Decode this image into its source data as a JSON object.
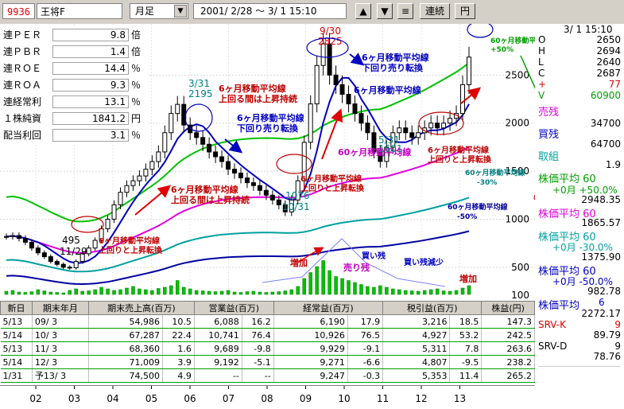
{
  "toolbar": {
    "code": "9936",
    "name": "王将F",
    "period": "月足",
    "daterange": "2001/ 2/28 〜  3/ 1 15:10",
    "btn_up": "▲",
    "btn_down": "▼",
    "btn_menu": "≡",
    "btn_continuous": "連続",
    "btn_yen": "円"
  },
  "fundamentals": [
    {
      "label": "連ＰＥＲ",
      "value": "9.8",
      "unit": "倍"
    },
    {
      "label": "連ＰＢＲ",
      "value": "1.4",
      "unit": "倍"
    },
    {
      "label": "連ＲＯＥ",
      "value": "14.4",
      "unit": "％"
    },
    {
      "label": "連ＲＯＡ",
      "value": "9.3",
      "unit": "％"
    },
    {
      "label": "連経常利",
      "value": "13.1",
      "unit": "％"
    },
    {
      "label": "１株純資",
      "value": "1841.2",
      "unit": "円"
    },
    {
      "label": "配当利回",
      "value": "3.1",
      "unit": "％"
    }
  ],
  "quote": {
    "time": "3/ 1 15:10",
    "rows": [
      {
        "k": "O",
        "v": "2650"
      },
      {
        "k": "H",
        "v": "2694"
      },
      {
        "k": "L",
        "v": "2640"
      },
      {
        "k": "C",
        "v": "2687"
      },
      {
        "k": "+",
        "v": "77"
      },
      {
        "k": "V",
        "v": "60900"
      }
    ],
    "uri_label": "売残",
    "uri_value": "34700",
    "kai_label": "買残",
    "kai_value": "64700",
    "tori_label": "取組",
    "tori_value": "1.9"
  },
  "ma_readouts": [
    {
      "title": "株価平均  60",
      "sub": "+0月 +50.0%",
      "value": "2948.35",
      "color": "#00a000"
    },
    {
      "title": "株価平均  60",
      "sub": "",
      "value": "1865.57",
      "color": "#e000e0"
    },
    {
      "title": "株価平均  60",
      "sub": "+0月 -30.0%",
      "value": "1375.90",
      "color": "#00a0a0"
    },
    {
      "title": "株価平均  60",
      "sub": "+0月 -50.0%",
      "value": "982.78",
      "color": "#0000c0"
    },
    {
      "title": "株価平均",
      "sub": "6",
      "value": "2272.17",
      "color": "#0000c0"
    }
  ],
  "srv": [
    {
      "label": "SRV-K",
      "n": "9",
      "value": "89.79",
      "color": "#e00000"
    },
    {
      "label": "SRV-D",
      "n": "9",
      "value": "78.76",
      "color": "#000000"
    }
  ],
  "annotations": {
    "a1": "6ヶ月移動平均線",
    "a1b": "上回る間は上昇持続",
    "a2": "6ヶ月移動平均線",
    "a2b": "下回り売り転換",
    "a3": "6ヶ月移動平均線",
    "a3b": "上回る間は上昇持続",
    "a4": "6ヶ月移動平均線",
    "a4b": "上回りと上昇転換",
    "a5": "6ヶ月移動平均線",
    "a5b": "上回りと上昇転換",
    "a6": "6ヶ月移動平均線",
    "a6b": "下回り売り転換",
    "a7": "6ヶ月移動平均線",
    "a8": "60ヶ月移動平均線",
    "a9": "6ヶ月移動平均線",
    "a9b": "上回りと上昇転換",
    "a10": "60ヶ月移動平均線",
    "a10b": "+50%",
    "a11": "60ヶ月移動平均線",
    "a11b": "-30%",
    "a12": "60ヶ月移動平均線",
    "a12b": "-50%",
    "v1": "増加",
    "v2": "売り残",
    "v3": "買い残",
    "v4": "買い残減少",
    "v5": "増加"
  },
  "price_labels": [
    {
      "t": "495",
      "c": "#000000"
    },
    {
      "t": "11/29",
      "c": "#000000"
    },
    {
      "t": "3/31",
      "c": "#008080"
    },
    {
      "t": "2195",
      "c": "#008080"
    },
    {
      "t": "9/30",
      "c": "#e00000"
    },
    {
      "t": "2825",
      "c": "#e00000"
    },
    {
      "t": "1076",
      "c": "#008080"
    },
    {
      "t": "10/31",
      "c": "#008080"
    },
    {
      "t": "1601",
      "c": "#008080"
    },
    {
      "t": "5/31",
      "c": "#008080"
    }
  ],
  "table": {
    "headers": [
      "新日",
      "期末年月",
      "期末売上高(百万)",
      "営業益(百万)",
      "経常益(百万)",
      "税引益(百万)",
      "株益(円)"
    ],
    "rows": [
      [
        "5/13",
        "09/ 3",
        "54,986",
        "10.5",
        "6,088",
        "16.2",
        "6,190",
        "17.9",
        "3,216",
        "18.5",
        "147.3"
      ],
      [
        "5/14",
        "10/ 3",
        "67,287",
        "22.4",
        "10,741",
        "76.4",
        "10,926",
        "76.5",
        "4,927",
        "53.2",
        "242.5"
      ],
      [
        "5/13",
        "11/ 3",
        "68,360",
        "1.6",
        "9,689",
        "-9.8",
        "9,929",
        "-9.1",
        "5,311",
        "7.8",
        "263.6"
      ],
      [
        "5/14",
        "12/ 3",
        "71,009",
        "3.9",
        "9,192",
        "-5.1",
        "9,271",
        "-6.6",
        "4,807",
        "-9.5",
        "238.2"
      ],
      [
        "1/31",
        "予13/ 3",
        "74,500",
        "4.9",
        "--",
        "--",
        "9,247",
        "-0.3",
        "5,353",
        "11.4",
        "265.2"
      ]
    ]
  },
  "chart_data": {
    "type": "candlestick",
    "title": "",
    "x_labels": [
      "02",
      "03",
      "04",
      "05",
      "06",
      "07",
      "08",
      "09",
      "10",
      "11",
      "12",
      "13"
    ],
    "y_ticks": [
      500,
      1000,
      1500,
      2000,
      2500
    ],
    "volume_tick": "100",
    "ylim": [
      300,
      2950
    ],
    "closes": [
      820,
      830,
      800,
      760,
      700,
      650,
      610,
      560,
      530,
      500,
      495,
      560,
      640,
      700,
      780,
      900,
      1000,
      1150,
      1280,
      1350,
      1400,
      1450,
      1520,
      1600,
      1700,
      1900,
      2100,
      2195,
      1980,
      1900,
      1850,
      1780,
      1700,
      1650,
      1600,
      1520,
      1480,
      1430,
      1380,
      1350,
      1300,
      1250,
      1200,
      1150,
      1076,
      1200,
      1400,
      1800,
      2200,
      2600,
      2825,
      2500,
      2400,
      2300,
      2200,
      2100,
      2000,
      1900,
      1700,
      1601,
      1750,
      1900,
      1950,
      1900,
      1850,
      1900,
      1950,
      2000,
      1950,
      2000,
      2050,
      2100,
      2400,
      2687
    ],
    "volumes": [
      8,
      10,
      6,
      5,
      7,
      12,
      9,
      6,
      5,
      4,
      10,
      14,
      8,
      9,
      12,
      18,
      14,
      10,
      12,
      16,
      20,
      14,
      12,
      10,
      15,
      18,
      22,
      35,
      18,
      14,
      10,
      9,
      8,
      7,
      8,
      10,
      6,
      5,
      7,
      8,
      6,
      5,
      6,
      7,
      9,
      12,
      20,
      40,
      55,
      70,
      85,
      60,
      45,
      40,
      35,
      30,
      25,
      20,
      18,
      22,
      18,
      14,
      12,
      10,
      9,
      8,
      10,
      12,
      14,
      9,
      8,
      10,
      16,
      22
    ],
    "ma6_color": "#0000c0",
    "ma60_color": "#e000e0",
    "band_plus50_color": "#00c000",
    "band_minus30_color": "#00a0a0",
    "band_minus50_color": "#0000a0",
    "series": [
      {
        "name": "6ヶ月移動平均線",
        "color": "#0000c0"
      },
      {
        "name": "60ヶ月移動平均線",
        "color": "#e000e0"
      }
    ]
  }
}
